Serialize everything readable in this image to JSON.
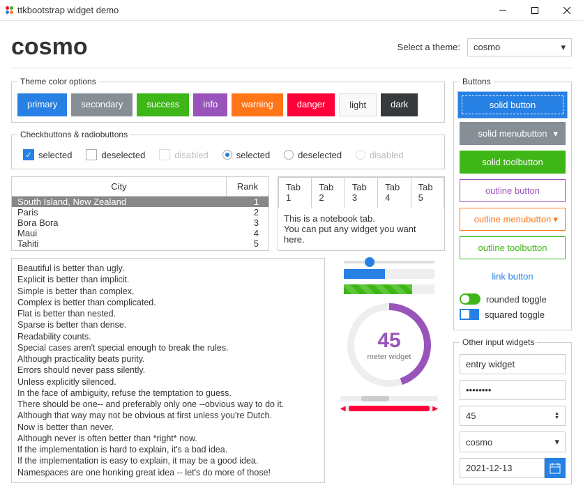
{
  "window_title": "ttkbootstrap widget demo",
  "header": {
    "title": "cosmo",
    "select_label": "Select a theme:",
    "select_value": "cosmo"
  },
  "theme_colors": {
    "legend": "Theme color options",
    "items": [
      {
        "label": "primary",
        "bg": "#2780e3"
      },
      {
        "label": "secondary",
        "bg": "#868e96"
      },
      {
        "label": "success",
        "bg": "#3fb618"
      },
      {
        "label": "info",
        "bg": "#9954bb"
      },
      {
        "label": "warning",
        "bg": "#ff7518"
      },
      {
        "label": "danger",
        "bg": "#ff0039"
      },
      {
        "label": "light",
        "bg": "#f8f9fa"
      },
      {
        "label": "dark",
        "bg": "#373a3c"
      }
    ]
  },
  "checks": {
    "legend": "Checkbuttons & radiobuttons",
    "cb_selected": "selected",
    "cb_deselected": "deselected",
    "cb_disabled": "disabled",
    "rb_selected": "selected",
    "rb_deselected": "deselected",
    "rb_disabled": "disabled"
  },
  "table": {
    "headers": {
      "city": "City",
      "rank": "Rank"
    },
    "rows": [
      {
        "city": "South Island, New Zealand",
        "rank": "1",
        "selected": true
      },
      {
        "city": "Paris",
        "rank": "2"
      },
      {
        "city": "Bora Bora",
        "rank": "3"
      },
      {
        "city": "Maui",
        "rank": "4"
      },
      {
        "city": "Tahiti",
        "rank": "5"
      }
    ]
  },
  "notebook": {
    "tabs": [
      "Tab 1",
      "Tab 2",
      "Tab 3",
      "Tab 4",
      "Tab 5"
    ],
    "active": 0,
    "body_line1": "This is a notebook tab.",
    "body_line2": "You can put any widget you want here."
  },
  "zen": [
    "Beautiful is better than ugly.",
    "Explicit is better than implicit.",
    "Simple is better than complex.",
    "Complex is better than complicated.",
    "Flat is better than nested.",
    "Sparse is better than dense.",
    "Readability counts.",
    "Special cases aren't special enough to break the rules.",
    "Although practicality beats purity.",
    "Errors should never pass silently.",
    "Unless explicitly silenced.",
    "In the face of ambiguity, refuse the temptation to guess.",
    "There should be one-- and preferably only one --obvious way to do it.",
    "Although that way may not be obvious at first unless you're Dutch.",
    "Now is better than never.",
    "Although never is often better than *right* now.",
    "If the implementation is hard to explain, it's a bad idea.",
    "If the implementation is easy to explain, it may be a good idea.",
    "Namespaces are one honking great idea -- let's do more of those!"
  ],
  "meter": {
    "value": "45",
    "label": "meter widget"
  },
  "buttons": {
    "legend": "Buttons",
    "solid": "solid button",
    "menub": "solid menubutton",
    "stool": "solid toolbutton",
    "outl": "outline button",
    "omenub": "outline menubutton",
    "otool": "outline toolbutton",
    "link": "link button",
    "rtoggle": "rounded toggle",
    "stoggle": "squared toggle"
  },
  "inputs": {
    "legend": "Other input widgets",
    "entry": "entry widget",
    "password": "••••••••",
    "spin": "45",
    "combo": "cosmo",
    "date": "2021-12-13"
  }
}
